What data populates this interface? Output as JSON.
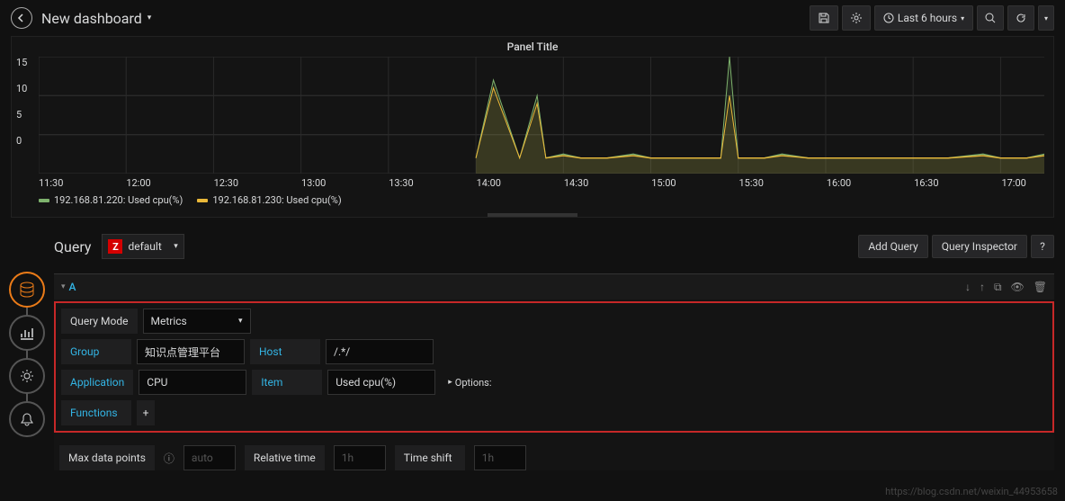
{
  "header": {
    "title": "New dashboard",
    "time_range": "Last 6 hours"
  },
  "panel": {
    "title": "Panel Title"
  },
  "legend": {
    "s1": "192.168.81.220: Used cpu(%)",
    "s2": "192.168.81.230: Used cpu(%)",
    "colors": {
      "s1": "#7eb26d",
      "s2": "#eab839"
    }
  },
  "chart_data": {
    "type": "line",
    "title": "Panel Title",
    "xlabel": "",
    "ylabel": "",
    "ylim": [
      0,
      15
    ],
    "x_tick_labels": [
      "11:30",
      "12:00",
      "12:30",
      "13:00",
      "13:30",
      "14:00",
      "14:30",
      "15:00",
      "15:30",
      "16:00",
      "16:30",
      "17:00"
    ],
    "series": [
      {
        "name": "192.168.81.220: Used cpu(%)",
        "color": "#7eb26d",
        "x": [
          0,
          1,
          2,
          3,
          4,
          5,
          5.2,
          5.5,
          5.7,
          5.8,
          6,
          6.2,
          6.5,
          6.8,
          7,
          7.2,
          7.5,
          7.8,
          7.9,
          8,
          8.1,
          8.3,
          8.5,
          8.8,
          9,
          9.3,
          9.6,
          10,
          10.4,
          10.8,
          11,
          11.3,
          11.5
        ],
        "y": [
          null,
          null,
          null,
          null,
          null,
          2,
          12,
          2,
          10,
          2,
          2.5,
          2,
          2,
          2.5,
          2,
          2,
          2,
          2,
          15,
          2,
          2,
          2,
          2.5,
          2,
          2,
          2,
          2,
          2,
          2,
          2.5,
          2,
          2,
          2.5
        ]
      },
      {
        "name": "192.168.81.230: Used cpu(%)",
        "color": "#eab839",
        "x": [
          0,
          1,
          2,
          3,
          4,
          5,
          5.2,
          5.5,
          5.7,
          5.8,
          6,
          6.2,
          6.5,
          6.8,
          7,
          7.2,
          7.5,
          7.8,
          7.9,
          8,
          8.1,
          8.3,
          8.5,
          8.8,
          9,
          9.3,
          9.6,
          10,
          10.4,
          10.8,
          11,
          11.3,
          11.5
        ],
        "y": [
          null,
          null,
          null,
          null,
          null,
          2,
          11,
          2,
          9,
          2,
          2.3,
          2,
          2,
          2.3,
          2,
          2,
          2,
          2,
          10,
          2,
          2,
          2,
          2.3,
          2,
          2,
          2,
          2,
          2,
          2,
          2.3,
          2,
          2,
          2.3
        ]
      }
    ]
  },
  "query_section": {
    "heading": "Query",
    "datasource": "default",
    "btn_add": "Add Query",
    "btn_inspector": "Query Inspector"
  },
  "queryA": {
    "letter": "A",
    "mode_label": "Query Mode",
    "mode_value": "Metrics",
    "group_label": "Group",
    "group_value": "知识点管理平台",
    "host_label": "Host",
    "host_value": "/.*/",
    "application_label": "Application",
    "application_value": "CPU",
    "item_label": "Item",
    "item_value": "Used cpu(%)",
    "options_label": "Options:",
    "functions_label": "Functions"
  },
  "footer_row": {
    "max_dp": "Max data points",
    "auto": "auto",
    "rel_time": "Relative time",
    "rel_ph": "1h",
    "shift": "Time shift",
    "shift_ph": "1h"
  },
  "watermark": "https://blog.csdn.net/weixin_44953658"
}
